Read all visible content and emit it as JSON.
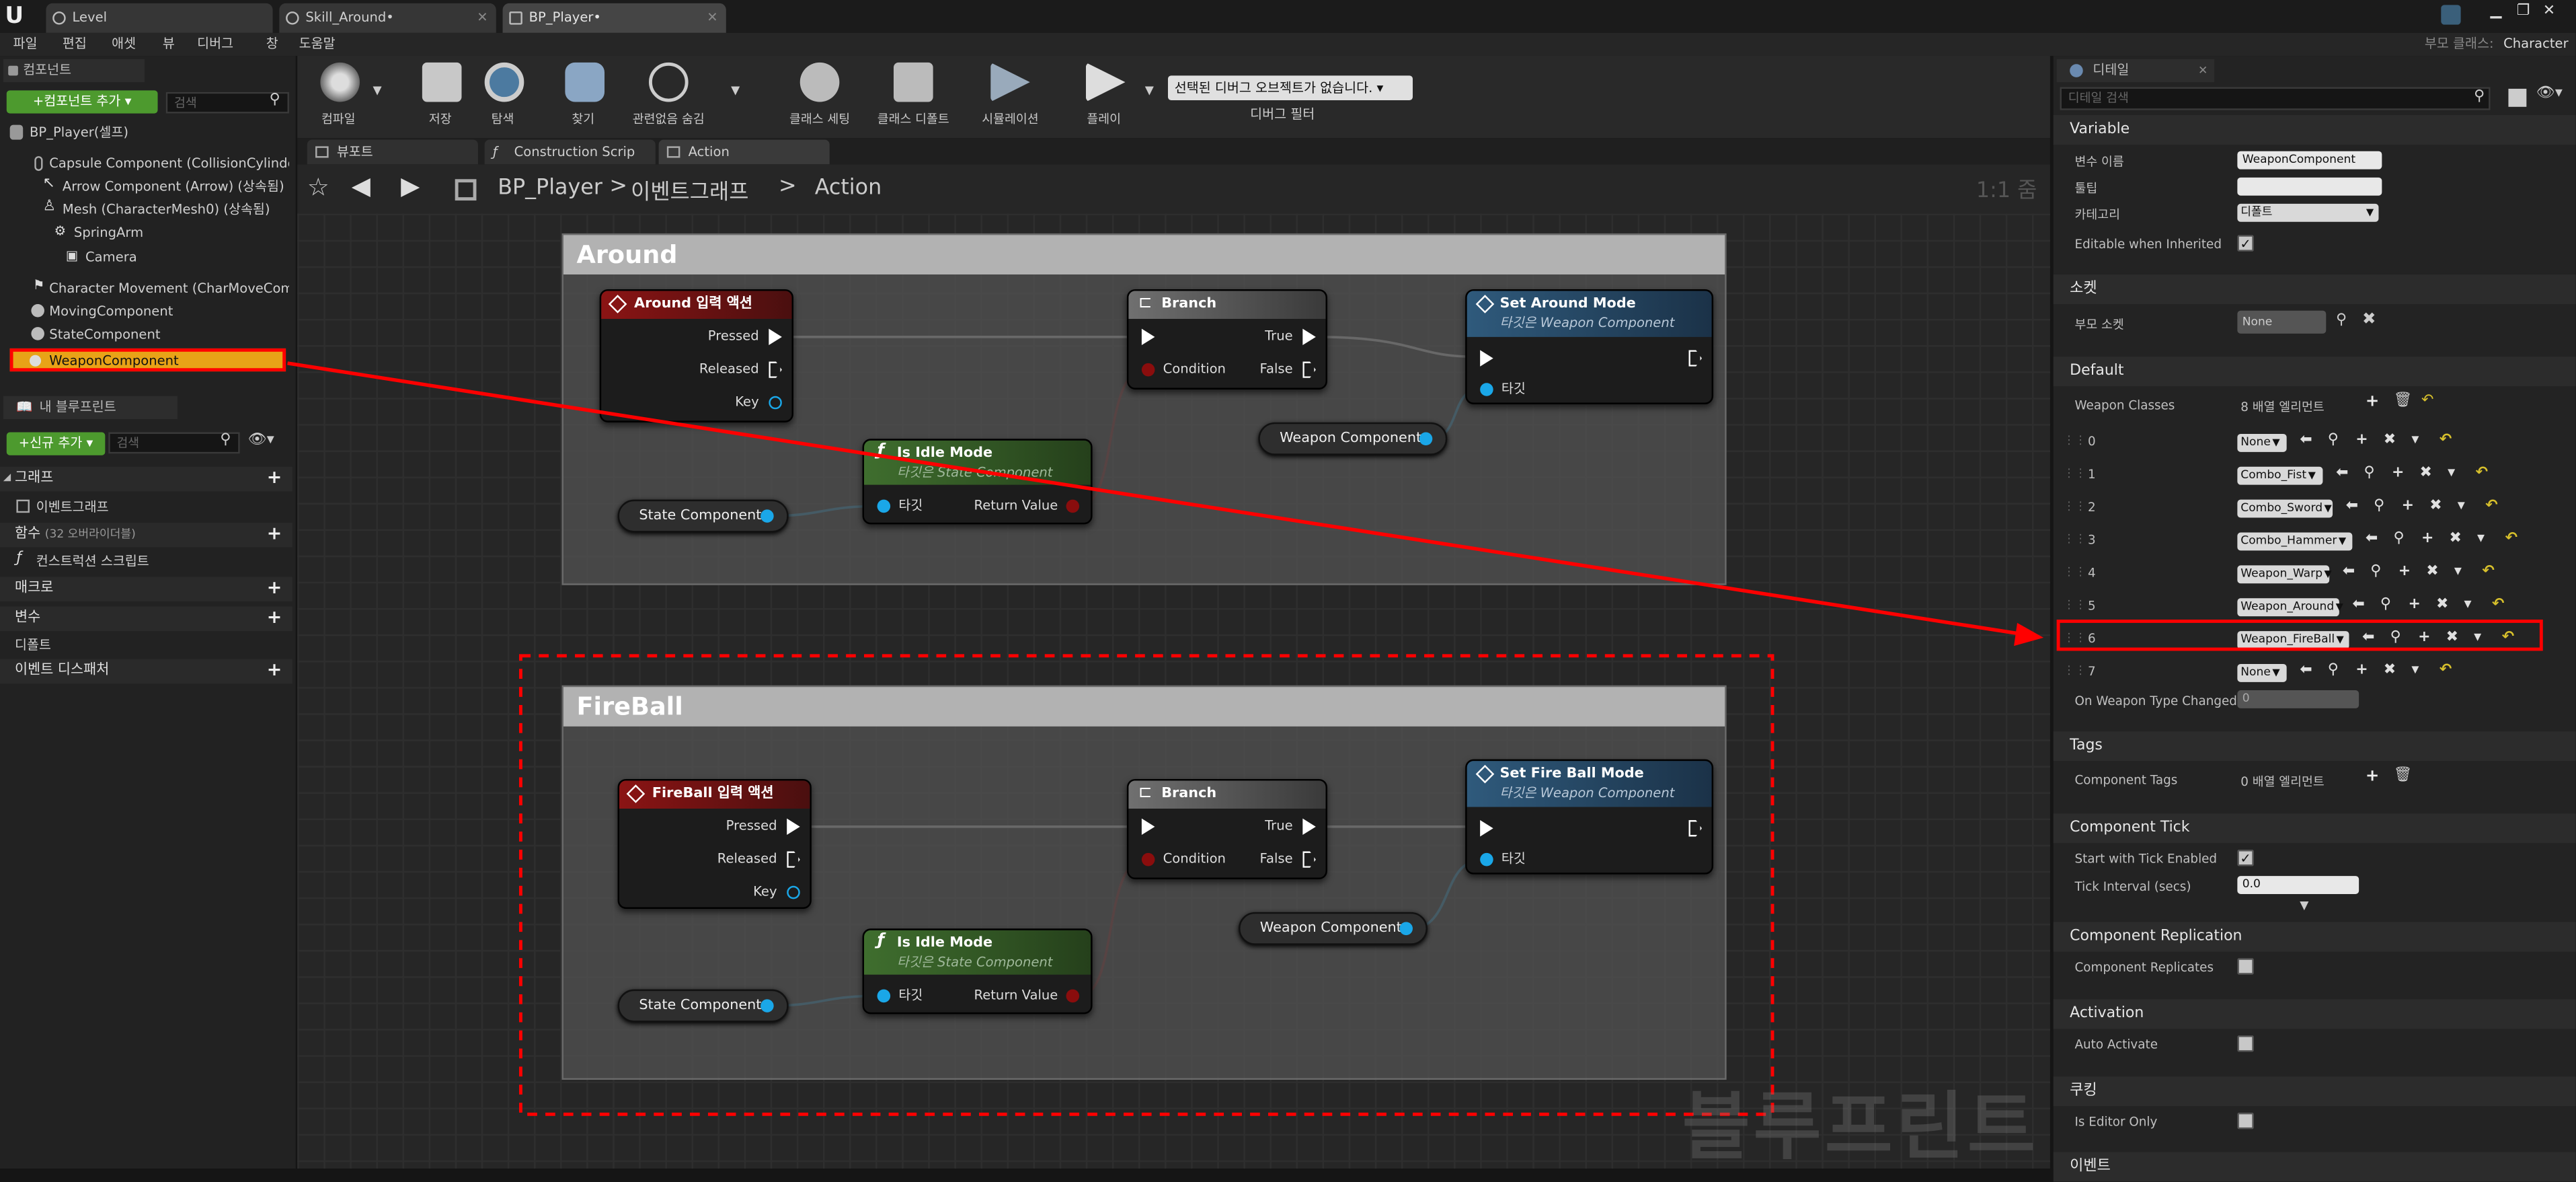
{
  "titlebar": {
    "tabs": [
      "Level",
      "Skill_Around•",
      "BP_Player•"
    ],
    "parent_class_label": "부모 클래스:",
    "parent_class_value": "Character"
  },
  "menu": [
    "파일",
    "편집",
    "애셋",
    "뷰",
    "디버그",
    "창",
    "도움말"
  ],
  "components": {
    "header": "컴포넌트",
    "add_button": "+컴포넌트 추가 ▾",
    "search_placeholder": "검색",
    "items": [
      "BP_Player(셀프)",
      "Capsule Component (CollisionCylinder)",
      "Arrow Component (Arrow) (상속됨)",
      "Mesh (CharacterMesh0) (상속됨)",
      "SpringArm",
      "Camera",
      "Character Movement (CharMoveComp)",
      "MovingComponent",
      "StateComponent",
      "WeaponComponent"
    ]
  },
  "my_blueprint": {
    "header": "내 블루프린트",
    "add_button": "+신규 추가 ▾",
    "search_placeholder": "검색",
    "sections": {
      "graph": "그래프",
      "event_graph": "이벤트그래프",
      "functions": "함수",
      "functions_note": "(32 오버라이더블)",
      "construction": "컨스트럭션 스크립트",
      "macros": "매크로",
      "variables": "변수",
      "default": "디폴트",
      "dispatchers": "이벤트 디스패처"
    }
  },
  "toolbar": {
    "buttons": [
      "컴파일",
      "저장",
      "탐색",
      "찾기",
      "관련없음 숨김",
      "클래스 세팅",
      "클래스 디폴트",
      "시뮬레이션",
      "플레이"
    ],
    "debug_select": "선택된 디버그 오브젝트가 없습니다. ▾",
    "debug_filter": "디버그 필터"
  },
  "graph_tabs": [
    "뷰포트",
    "Construction Scrip",
    "Action"
  ],
  "breadcrumb": {
    "root": "BP_Player",
    "mid": "이벤트그래프",
    "leaf": "Action",
    "zoom": "1:1 줌"
  },
  "graph": {
    "around": {
      "title": "Around",
      "input_node": "Around 입력 액션",
      "pressed": "Pressed",
      "released": "Released",
      "key": "Key",
      "state_component": "State Component",
      "idle_title": "Is Idle Mode",
      "idle_sub": "타깃은 State Component",
      "target": "타깃",
      "return_value": "Return Value",
      "branch": "Branch",
      "condition": "Condition",
      "true": "True",
      "false": "False",
      "weapon_component": "Weapon Component",
      "set_node": "Set Around Mode",
      "set_sub": "타깃은 Weapon Component"
    },
    "fireball": {
      "title": "FireBall",
      "input_node": "FireBall 입력 액션",
      "pressed": "Pressed",
      "released": "Released",
      "key": "Key",
      "state_component": "State Component",
      "idle_title": "Is Idle Mode",
      "idle_sub": "타깃은 State Component",
      "target": "타깃",
      "return_value": "Return Value",
      "branch": "Branch",
      "condition": "Condition",
      "true": "True",
      "false": "False",
      "weapon_component": "Weapon Component",
      "set_node": "Set Fire Ball Mode",
      "set_sub": "타깃은 Weapon Component"
    },
    "watermark": "블루프린트"
  },
  "details": {
    "header": "디테일",
    "search_placeholder": "디테일 검색",
    "variable": {
      "title": "Variable",
      "name_label": "변수 이름",
      "name_value": "WeaponComponent",
      "tooltip_label": "툴팁",
      "category_label": "카테고리",
      "category_value": "디폴트",
      "editable_label": "Editable when Inherited"
    },
    "socket": {
      "title": "소켓",
      "parent_label": "부모 소켓",
      "parent_value": "None"
    },
    "default": {
      "title": "Default",
      "weapon_classes_label": "Weapon Classes",
      "weapon_classes_value": "8 배열 엘리먼트",
      "entries": [
        {
          "idx": "0",
          "val": "None"
        },
        {
          "idx": "1",
          "val": "Combo_Fist"
        },
        {
          "idx": "2",
          "val": "Combo_Sword"
        },
        {
          "idx": "3",
          "val": "Combo_Hammer"
        },
        {
          "idx": "4",
          "val": "Weapon_Warp"
        },
        {
          "idx": "5",
          "val": "Weapon_Around"
        },
        {
          "idx": "6",
          "val": "Weapon_FireBall"
        },
        {
          "idx": "7",
          "val": "None"
        }
      ],
      "on_changed_label": "On Weapon Type Changed",
      "on_changed_value": "0"
    },
    "tags": {
      "title": "Tags",
      "label": "Component Tags",
      "value": "0 배열 엘리먼트"
    },
    "tick": {
      "title": "Component Tick",
      "start_label": "Start with Tick Enabled",
      "interval_label": "Tick Interval (secs)",
      "interval_value": "0.0"
    },
    "replication": {
      "title": "Component Replication",
      "label": "Component Replicates"
    },
    "activation": {
      "title": "Activation",
      "label": "Auto Activate"
    },
    "cooking": {
      "title": "쿠킹",
      "label": "Is Editor Only"
    },
    "events": {
      "title": "이벤트"
    }
  },
  "colors": {
    "highlight": "#ff0000",
    "selection": "#e8a317",
    "input_header": "#8b1414",
    "func_header": "#3f6e2e",
    "set_header": "#2f5a7c",
    "exec": "#ffffff",
    "object_pin": "#1aa7e8",
    "bool_pin": "#8a0d0d"
  }
}
